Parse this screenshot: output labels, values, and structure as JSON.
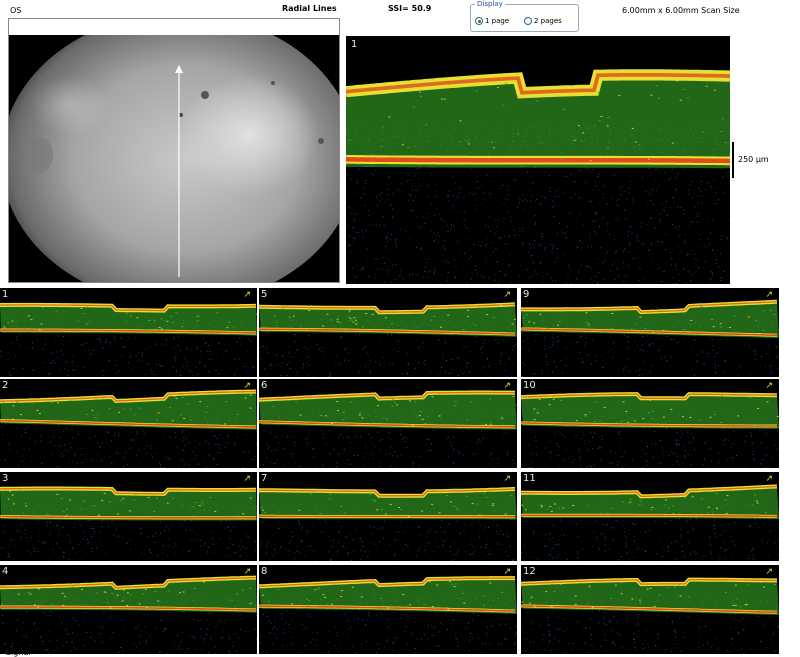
{
  "header": {
    "eye": "OS",
    "scan_pattern": "Radial Lines",
    "ssi": "SSI= 50.9",
    "scan_size": "6.00mm x 6.00mm Scan Size"
  },
  "display": {
    "legend": "Display",
    "options": [
      {
        "label": "1 page",
        "selected": true
      },
      {
        "label": "2 pages",
        "selected": false
      }
    ]
  },
  "main_scan": {
    "number": "1",
    "scale_label": "250 µm"
  },
  "thumbnails": [
    "1",
    "5",
    "9",
    "2",
    "6",
    "10",
    "3",
    "7",
    "11",
    "4",
    "8",
    "12"
  ],
  "bottom_label": "Signal",
  "colors": {
    "scan_bg": "#000000",
    "retina_green": "#3dbb2a",
    "retina_yellow": "#e6e030",
    "retina_red": "#e04a1c",
    "noise_blue": "#2f6fd0",
    "arrow": "#ffffff",
    "display_label": "#1f4fa6"
  }
}
